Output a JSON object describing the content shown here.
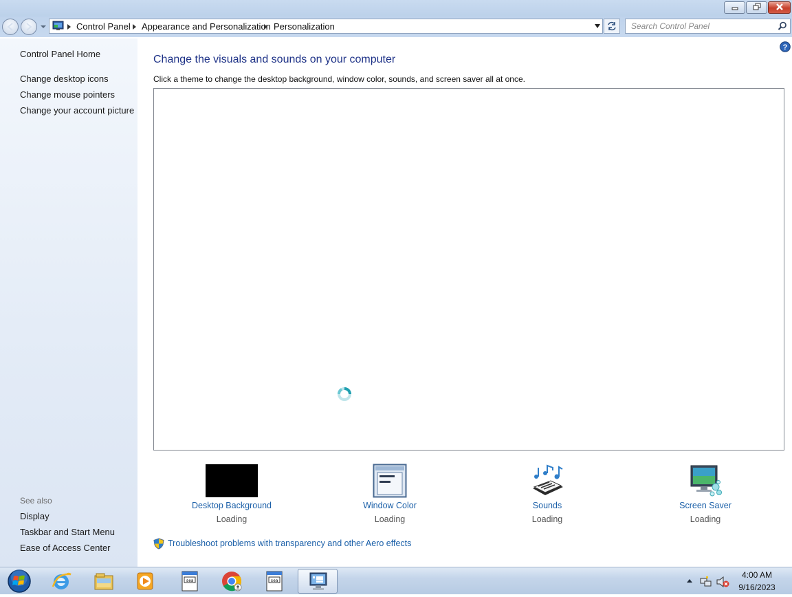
{
  "address_bar": {
    "breadcrumbs": [
      "Control Panel",
      "Appearance and Personalization",
      "Personalization"
    ]
  },
  "search": {
    "placeholder": "Search Control Panel"
  },
  "left_pane": {
    "home_link": "Control Panel Home",
    "tasks": [
      "Change desktop icons",
      "Change mouse pointers",
      "Change your account picture"
    ],
    "see_also_heading": "See also",
    "see_also": [
      "Display",
      "Taskbar and Start Menu",
      "Ease of Access Center"
    ]
  },
  "main": {
    "title": "Change the visuals and sounds on your computer",
    "subtitle": "Click a theme to change the desktop background, window color, sounds, and screen saver all at once.",
    "tiles": [
      {
        "label": "Desktop Background",
        "status": "Loading",
        "icon": "desktop-background-thumbnail"
      },
      {
        "label": "Window Color",
        "status": "Loading",
        "icon": "window-color-icon"
      },
      {
        "label": "Sounds",
        "status": "Loading",
        "icon": "sounds-icon"
      },
      {
        "label": "Screen Saver",
        "status": "Loading",
        "icon": "screen-saver-icon"
      }
    ],
    "troubleshoot_link": "Troubleshoot problems with transparency and other Aero effects"
  },
  "taskbar": {
    "items": [
      "start-orb-icon",
      "internet-explorer-icon",
      "file-explorer-icon",
      "media-player-icon",
      "notepad-icon",
      "chrome-icon",
      "notepad-icon",
      "personalization-icon"
    ],
    "clock": {
      "time": "4:00 AM",
      "date": "9/16/2023"
    }
  },
  "colors": {
    "link": "#1a5fa8",
    "title": "#1e3287",
    "close_button": "#c7402c"
  }
}
